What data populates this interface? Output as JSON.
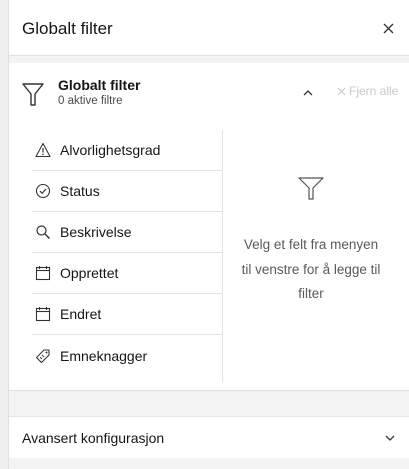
{
  "header": {
    "title": "Globalt filter",
    "close_icon": "close-icon"
  },
  "filter": {
    "title": "Globalt filter",
    "subtitle": "0 aktive filtre",
    "clear_all_label": "Fjern alle",
    "collapse_icon": "chevron-up-icon"
  },
  "fields": [
    {
      "label": "Alvorlighetsgrad",
      "icon": "warning-icon"
    },
    {
      "label": "Status",
      "icon": "check-circle-icon"
    },
    {
      "label": "Beskrivelse",
      "icon": "search-icon"
    },
    {
      "label": "Opprettet",
      "icon": "calendar-icon"
    },
    {
      "label": "Endret",
      "icon": "calendar-icon"
    },
    {
      "label": "Emneknagger",
      "icon": "tag-icon"
    }
  ],
  "empty_state": {
    "text": "Velg et felt fra menyen til venstre for å legge til filter"
  },
  "advanced": {
    "label": "Avansert konfigurasjon",
    "icon": "chevron-down-icon"
  },
  "colors": {
    "text": "#151515",
    "muted": "#5a5a5a",
    "disabled": "#c8c8c8",
    "border": "#e0e0e0",
    "background": "#f3f3f3"
  }
}
